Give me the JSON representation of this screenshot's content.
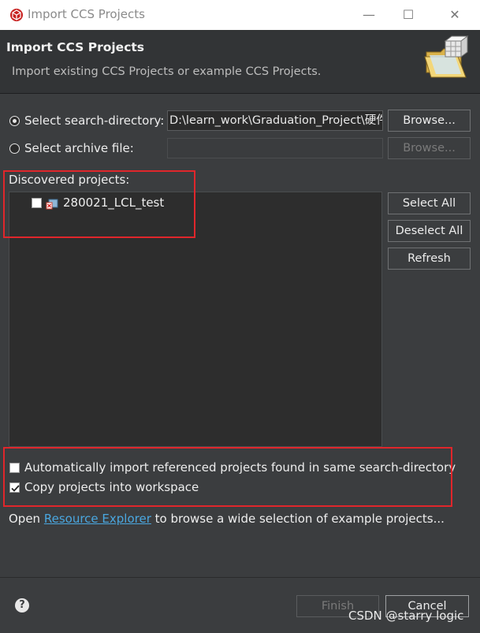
{
  "window": {
    "title": "Import CCS Projects",
    "minimize": "—",
    "maximize": "☐",
    "close": "✕"
  },
  "header": {
    "title": "Import CCS Projects",
    "subtitle": "Import existing CCS Projects or example CCS Projects."
  },
  "source": {
    "search_dir_label": "Select search-directory:",
    "search_dir_value": "D:\\learn_work\\Graduation_Project\\硬件",
    "archive_label": "Select archive file:",
    "archive_value": "",
    "browse_label": "Browse...",
    "browse_disabled_label": "Browse..."
  },
  "projects": {
    "label": "Discovered projects:",
    "items": [
      {
        "name": "280021_LCL_test",
        "checked": false
      }
    ],
    "select_all": "Select All",
    "deselect_all": "Deselect All",
    "refresh": "Refresh"
  },
  "options": {
    "auto_import": "Automatically import referenced projects found in same search-directory",
    "auto_import_checked": false,
    "copy_projects": "Copy projects into workspace",
    "copy_projects_checked": true
  },
  "info": {
    "prefix": "Open ",
    "link": "Resource Explorer",
    "suffix": " to browse a wide selection of example projects..."
  },
  "footer": {
    "help": "?",
    "finish": "Finish",
    "cancel": "Cancel"
  },
  "watermark": "CSDN @starry logic",
  "colors": {
    "accent_link": "#4aa7e0",
    "highlight_box": "#e0262b",
    "dialog_bg": "#3b3d3f"
  }
}
